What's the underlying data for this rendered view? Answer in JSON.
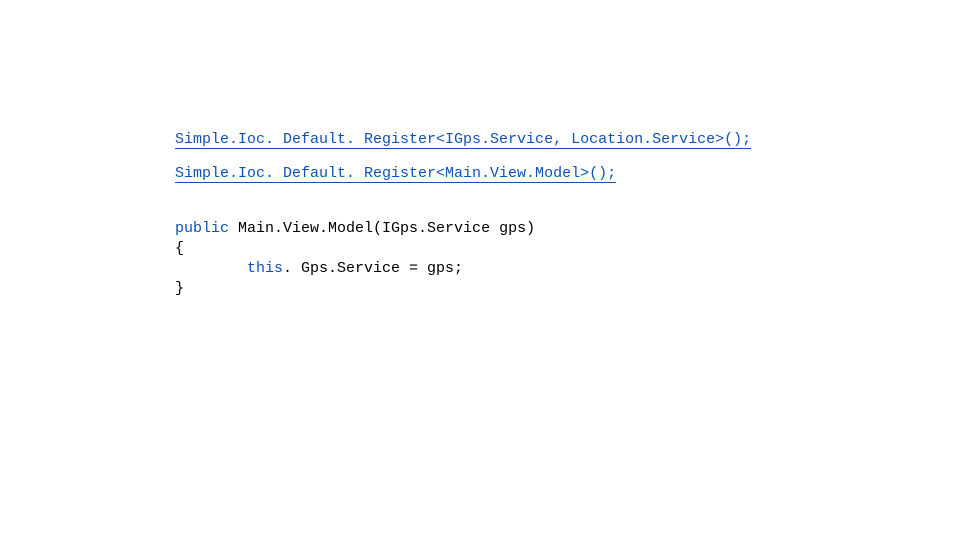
{
  "code": {
    "line1": {
      "a": "Simple.Ioc. Default. Register<",
      "b": "IGps.Service",
      "c": ", ",
      "d": "Location.Service",
      "e": ">();"
    },
    "line2": {
      "a": "Simple.Ioc. Default. Register<",
      "b": "Main.View.Model",
      "c": ">();"
    },
    "line3": {
      "a": "public",
      "b": " Main.View.Model(",
      "c": "IGps.Service",
      "d": " gps)"
    },
    "line4": "{",
    "line5": {
      "indent": "        ",
      "a": "this",
      "b": ". Gps.Service = gps;"
    },
    "line6": "}"
  }
}
